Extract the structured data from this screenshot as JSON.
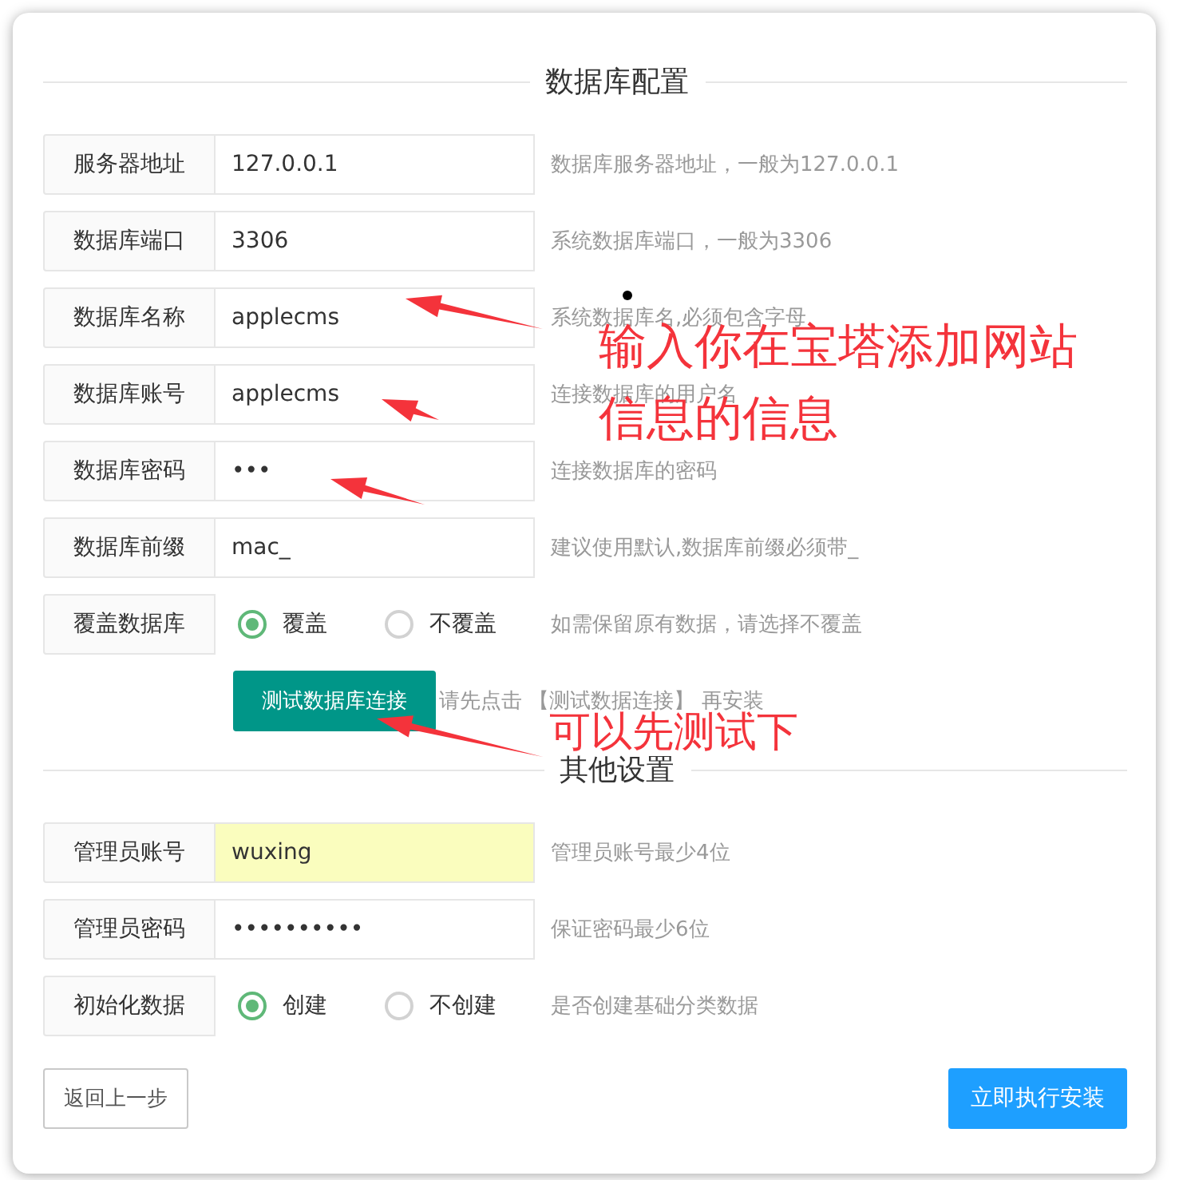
{
  "sections": [
    {
      "title": "数据库配置",
      "fields": [
        {
          "label": "服务器地址",
          "kind": "text",
          "value": "127.0.0.1",
          "highlighted": false,
          "hint": "数据库服务器地址，一般为127.0.0.1"
        },
        {
          "label": "数据库端口",
          "kind": "text",
          "value": "3306",
          "highlighted": false,
          "hint": "系统数据库端口，一般为3306"
        },
        {
          "label": "数据库名称",
          "kind": "text",
          "value": "applecms",
          "highlighted": false,
          "hint": "系统数据库名,必须包含字母"
        },
        {
          "label": "数据库账号",
          "kind": "text",
          "value": "applecms",
          "highlighted": false,
          "hint": "连接数据库的用户名"
        },
        {
          "label": "数据库密码",
          "kind": "text",
          "value": "•••",
          "highlighted": false,
          "hint": "连接数据库的密码"
        },
        {
          "label": "数据库前缀",
          "kind": "text",
          "value": "mac_",
          "highlighted": false,
          "hint": "建议使用默认,数据库前缀必须带_"
        },
        {
          "label": "覆盖数据库",
          "kind": "radio",
          "options": [
            {
              "label": "覆盖",
              "selected": true
            },
            {
              "label": "不覆盖",
              "selected": false
            }
          ],
          "hint": "如需保留原有数据，请选择不覆盖"
        }
      ],
      "test_button": {
        "label": "测试数据库连接",
        "note": "请先点击 【测试数据连接】 再安装"
      }
    },
    {
      "title": "其他设置",
      "fields": [
        {
          "label": "管理员账号",
          "kind": "text",
          "value": "wuxing",
          "highlighted": true,
          "hint": "管理员账号最少4位"
        },
        {
          "label": "管理员密码",
          "kind": "text",
          "value": "••••••••••",
          "highlighted": false,
          "hint": "保证密码最少6位"
        },
        {
          "label": "初始化数据",
          "kind": "radio",
          "options": [
            {
              "label": "创建",
              "selected": true
            },
            {
              "label": "不创建",
              "selected": false
            }
          ],
          "hint": "是否创建基础分类数据"
        }
      ]
    }
  ],
  "buttons": {
    "back": "返回上一步",
    "install": "立即执行安装"
  },
  "annotations": [
    {
      "text": "输入你在宝塔添加网站"
    },
    {
      "text": "信息的信息"
    },
    {
      "text": "可以先测试下"
    }
  ]
}
